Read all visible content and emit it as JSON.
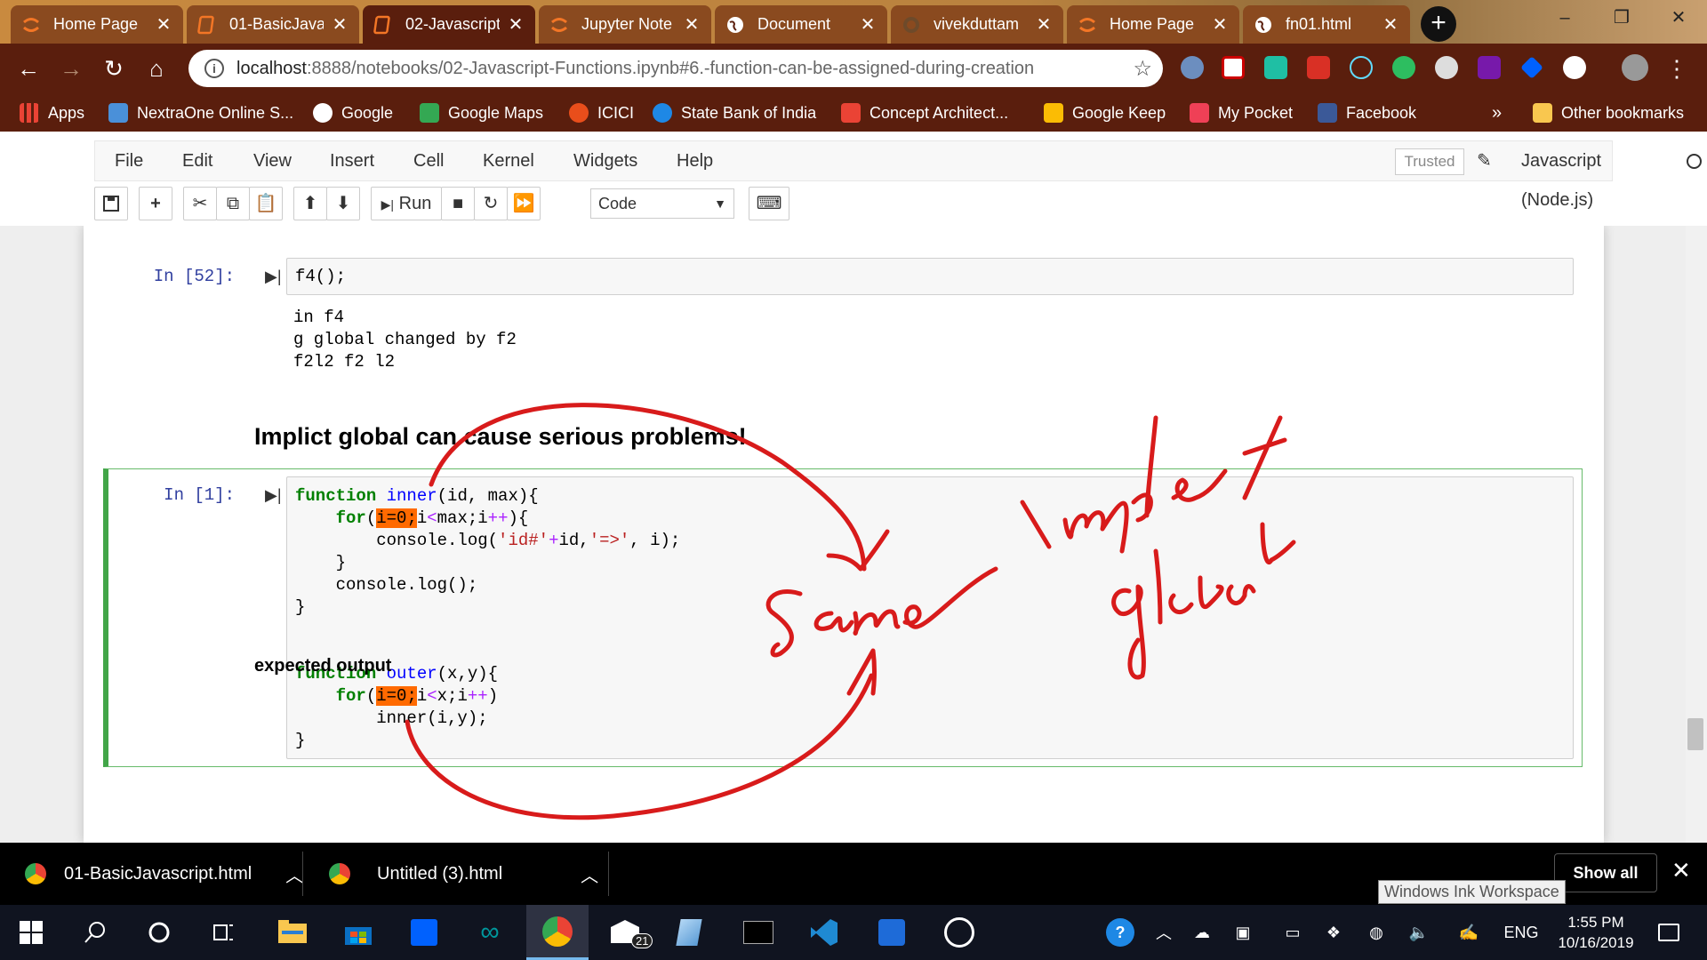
{
  "browser": {
    "tabs": [
      {
        "title": "Home Page",
        "icon": "jupyter-icon"
      },
      {
        "title": "01-BasicJava",
        "icon": "html-file-icon"
      },
      {
        "title": "02-Javascript",
        "icon": "html-file-icon",
        "active": true
      },
      {
        "title": "Jupyter Note",
        "icon": "jupyter-icon"
      },
      {
        "title": "Document",
        "icon": "globe-icon"
      },
      {
        "title": "vivekduttam",
        "icon": "github-icon"
      },
      {
        "title": "Home Page",
        "icon": "jupyter-icon"
      },
      {
        "title": "fn01.html",
        "icon": "globe-icon"
      }
    ],
    "tab_close_glyph": "✕",
    "new_tab_glyph": "+",
    "url_host": "localhost",
    "url_rest": ":8888/notebooks/02-Javascript-Functions.ipynb#6.-function-can-be-assigned-during-creation",
    "bookmarks": [
      {
        "label": "Apps",
        "color": "#ea4335"
      },
      {
        "label": "NextraOne Online S...",
        "color": "#4a90d9"
      },
      {
        "label": "Google",
        "color": "#ffffff"
      },
      {
        "label": "Google Maps",
        "color": "#34a853"
      },
      {
        "label": "ICICI",
        "color": "#e94e1b"
      },
      {
        "label": "State Bank of India",
        "color": "#1e88e5"
      },
      {
        "label": "Concept Architect...",
        "color": "#ea4335"
      },
      {
        "label": "Google Keep",
        "color": "#fbbc04"
      },
      {
        "label": "My Pocket",
        "color": "#ef4056"
      },
      {
        "label": "Facebook",
        "color": "#3b5998"
      }
    ],
    "bookmarks_overflow": "»",
    "other_bookmarks": "Other bookmarks"
  },
  "jupyter": {
    "menu": [
      "File",
      "Edit",
      "View",
      "Insert",
      "Cell",
      "Kernel",
      "Widgets",
      "Help"
    ],
    "trusted": "Trusted",
    "kernel": "Javascript (Node.js)",
    "run_label": "Run",
    "cell_type": "Code"
  },
  "cells": {
    "c1_prompt": "In [52]:",
    "c1_code": "f4();",
    "c1_output": [
      "in f4",
      "g global changed by f2",
      "f2l2 f2 l2"
    ],
    "md_heading": "Implict global can cause serious problems!",
    "c2_prompt": "In [1]:",
    "md_expected": "expected output"
  },
  "annotations": {
    "word1": "Same",
    "word2": "Implict",
    "word3": "global",
    "ink_color": "#d81b1b"
  },
  "downloads": {
    "items": [
      "01-BasicJavascript.html",
      "Untitled (3).html"
    ],
    "show_all": "Show all",
    "tooltip": "Windows Ink Workspace"
  },
  "taskbar": {
    "mail_badge": "21",
    "language": "ENG",
    "time": "1:55 PM",
    "date": "10/16/2019"
  }
}
